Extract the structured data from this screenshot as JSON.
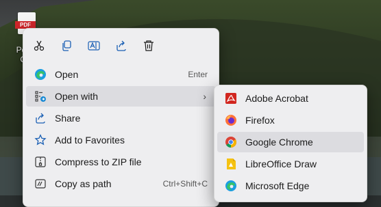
{
  "desktop": {
    "file_icon": {
      "badge": "PDF",
      "label_line1": "PdfR",
      "label_line2": "Co"
    }
  },
  "context_menu": {
    "toolbar": [
      {
        "name": "cut-icon"
      },
      {
        "name": "copy-icon"
      },
      {
        "name": "rename-icon"
      },
      {
        "name": "share-icon"
      },
      {
        "name": "delete-icon"
      }
    ],
    "items": [
      {
        "label": "Open",
        "accelerator": "Enter",
        "icon": "edge-icon"
      },
      {
        "label": "Open with",
        "accelerator": "",
        "icon": "open-with-icon",
        "has_submenu": true,
        "highlighted": true
      },
      {
        "label": "Share",
        "accelerator": "",
        "icon": "share-icon"
      },
      {
        "label": "Add to Favorites",
        "accelerator": "",
        "icon": "star-icon"
      },
      {
        "label": "Compress to ZIP file",
        "accelerator": "",
        "icon": "zip-icon"
      },
      {
        "label": "Copy as path",
        "accelerator": "Ctrl+Shift+C",
        "icon": "copy-path-icon"
      }
    ]
  },
  "open_with_submenu": {
    "items": [
      {
        "label": "Adobe Acrobat",
        "icon": "adobe-acrobat-icon"
      },
      {
        "label": "Firefox",
        "icon": "firefox-icon"
      },
      {
        "label": "Google Chrome",
        "icon": "chrome-icon",
        "highlighted": true
      },
      {
        "label": "LibreOffice Draw",
        "icon": "libreoffice-draw-icon"
      },
      {
        "label": "Microsoft Edge",
        "icon": "edge-icon"
      }
    ]
  },
  "colors": {
    "menu_bg": "#eeeef0",
    "highlight": "#dcdce0",
    "acrobat_red": "#d1261f",
    "chrome_blue": "#4285f4"
  }
}
